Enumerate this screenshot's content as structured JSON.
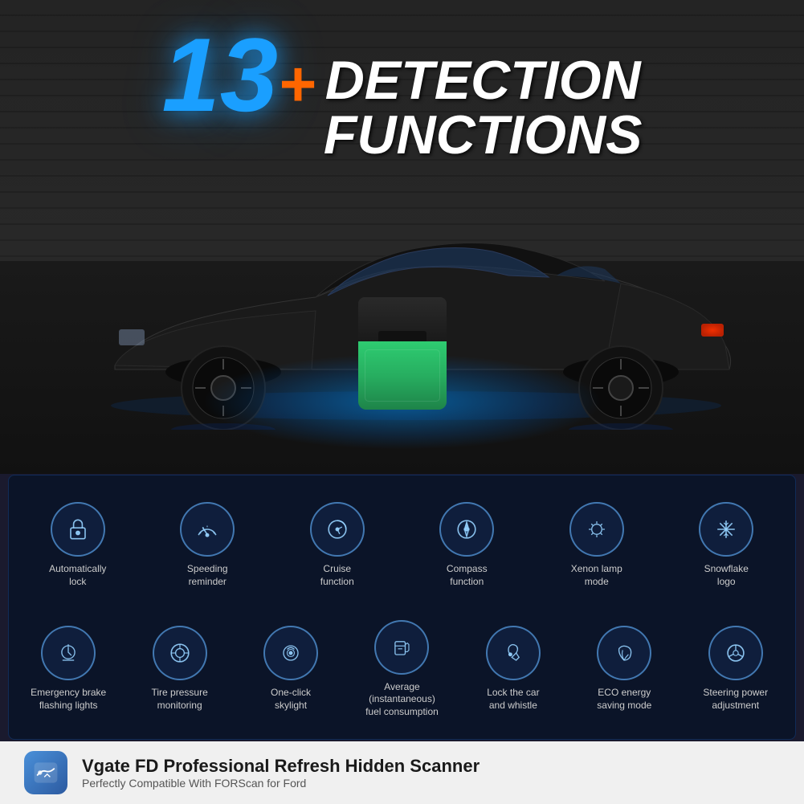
{
  "header": {
    "number": "13",
    "plus": "+",
    "line1": "DETECTION",
    "line2": "FUNCTIONS"
  },
  "functions_row1": [
    {
      "id": "auto-lock",
      "label": "Automatically\nlock",
      "icon": "lock"
    },
    {
      "id": "speed-reminder",
      "label": "Speeding\nreminder",
      "icon": "speedometer"
    },
    {
      "id": "cruise",
      "label": "Cruise\nfunction",
      "icon": "cruise"
    },
    {
      "id": "compass",
      "label": "Compass\nfunction",
      "icon": "compass"
    },
    {
      "id": "xenon",
      "label": "Xenon lamp\nmode",
      "icon": "bulb"
    },
    {
      "id": "snowflake",
      "label": "Snowflake\nlogo",
      "icon": "snowflake"
    }
  ],
  "functions_row2": [
    {
      "id": "emergency-brake",
      "label": "Emergency brake\nflashing lights",
      "icon": "bulb-flash"
    },
    {
      "id": "tire-pressure",
      "label": "Tire pressure\nmonitoring",
      "icon": "tire"
    },
    {
      "id": "one-click-skylight",
      "label": "One-click\nskylight",
      "icon": "skylight"
    },
    {
      "id": "fuel-consumption",
      "label": "Average (instantaneous)\nfuel consumption",
      "icon": "fuel"
    },
    {
      "id": "lock-whistle",
      "label": "Lock the car\nand whistle",
      "icon": "lock-whistle"
    },
    {
      "id": "eco-mode",
      "label": "ECO energy\nsaving mode",
      "icon": "eco"
    },
    {
      "id": "steering-power",
      "label": "Steering power\nadjustment",
      "icon": "steering"
    }
  ],
  "bottom": {
    "title": "Vgate FD Professional Refresh Hidden Scanner",
    "subtitle": "Perfectly Compatible With FORScan for Ford"
  }
}
